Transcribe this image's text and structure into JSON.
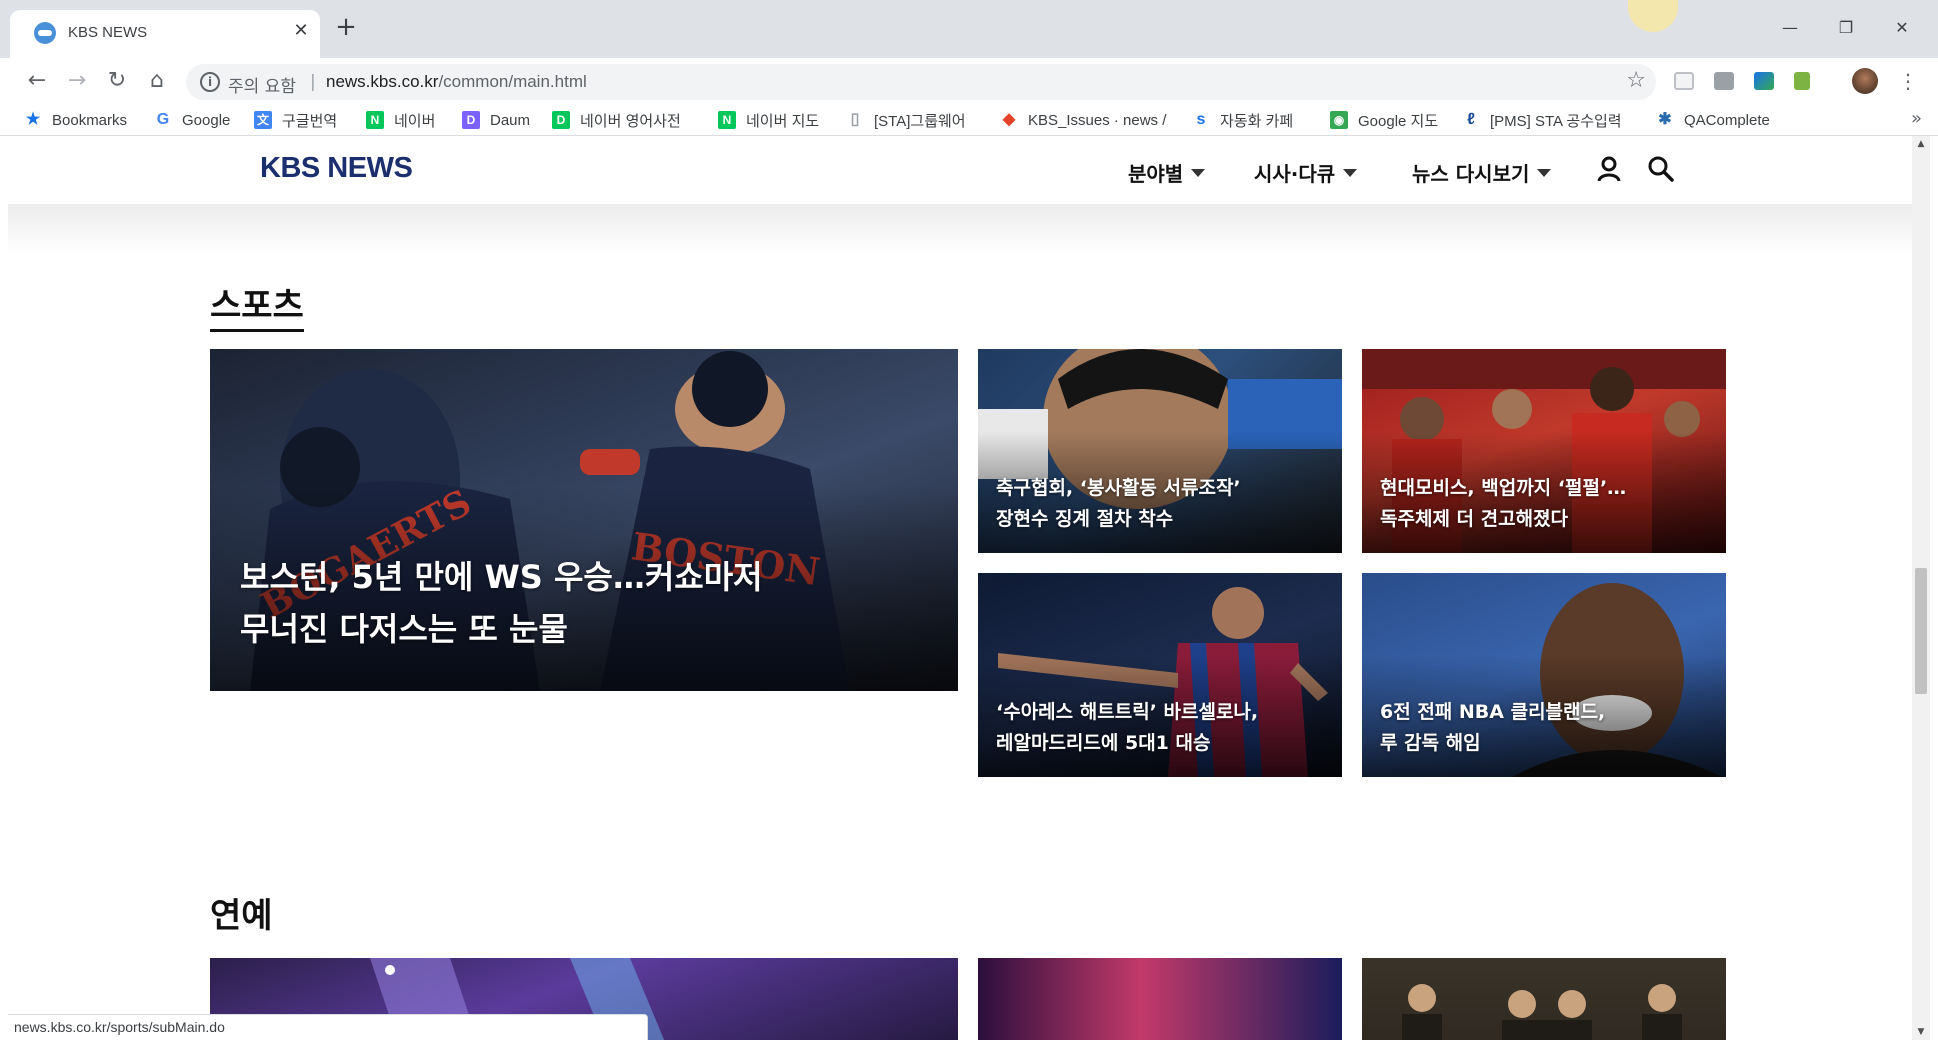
{
  "browser": {
    "tab_title": "KBS NEWS",
    "tab_close": "✕",
    "new_tab": "+",
    "window_controls": {
      "minimize": "—",
      "restore": "❐",
      "close": "✕"
    },
    "nav": {
      "back": "←",
      "forward": "→",
      "reload": "↻",
      "home": "⌂"
    },
    "omnibox": {
      "info_icon": "i",
      "security_text": "주의 요함",
      "separator": "|",
      "url_host": "news.kbs.co.kr",
      "url_path": "/common/main.html",
      "star": "☆"
    },
    "menu_glyph": "⋮",
    "bookmarks": [
      {
        "label": "Bookmarks",
        "icon": "star-icon",
        "glyph": "★",
        "color": "#1a73e8"
      },
      {
        "label": "Google",
        "icon": "google-icon",
        "glyph": "G",
        "color": "#4285f4"
      },
      {
        "label": "구글번역",
        "icon": "translate-icon",
        "glyph": "文",
        "color": "#4285f4"
      },
      {
        "label": "네이버",
        "icon": "naver-icon",
        "glyph": "N",
        "color": "#03c75a"
      },
      {
        "label": "Daum",
        "icon": "daum-icon",
        "glyph": "D",
        "color": "#7b61ff"
      },
      {
        "label": "네이버 영어사전",
        "icon": "dict-icon",
        "glyph": "D",
        "color": "#03c75a"
      },
      {
        "label": "네이버 지도",
        "icon": "naver-map-icon",
        "glyph": "N",
        "color": "#03c75a"
      },
      {
        "label": "[STA]그룹웨어",
        "icon": "page-icon",
        "glyph": "▯",
        "color": "#9aa0a6"
      },
      {
        "label": "KBS_Issues · news /",
        "icon": "gitlab-icon",
        "glyph": "◆",
        "color": "#e24329"
      },
      {
        "label": "자동화 카페",
        "icon": "sta-icon",
        "glyph": "s",
        "color": "#1a73e8"
      },
      {
        "label": "Google 지도",
        "icon": "maps-icon",
        "glyph": "◉",
        "color": "#34a853"
      },
      {
        "label": "[PMS] STA 공수입력",
        "icon": "pms-icon",
        "glyph": "ℓ",
        "color": "#1a4a9b"
      },
      {
        "label": "QAComplete",
        "icon": "qacomplete-icon",
        "glyph": "✱",
        "color": "#2b6cb0"
      }
    ],
    "bookmarks_more": "»",
    "status_url": "news.kbs.co.kr/sports/subMain.do"
  },
  "site": {
    "logo": "KBS NEWS",
    "nav": [
      {
        "label": "분야별"
      },
      {
        "label": "시사·다큐"
      },
      {
        "label": "뉴스 다시보기"
      }
    ]
  },
  "sports": {
    "title": "스포츠",
    "main": {
      "caption_line1": "보스턴, 5년 만에 WS 우승…커쇼마저",
      "caption_line2": "무너진 다저스는 또 눈물"
    },
    "cards": [
      {
        "line1": "축구협회, ‘봉사활동 서류조작’",
        "line2": "장현수 징계 절차 착수"
      },
      {
        "line1": "현대모비스, 백업까지 ‘펄펄’…",
        "line2": "독주체제 더 견고해졌다"
      },
      {
        "line1": "‘수아레스 해트트릭’ 바르셀로나,",
        "line2": "레알마드리드에 5대1 대승"
      },
      {
        "line1": "6전 전패 NBA 클리블랜드,",
        "line2": "루 감독 해임"
      }
    ]
  },
  "entertainment": {
    "title": "연예"
  },
  "colors": {
    "logo": "#1b2f6e",
    "chrome_frame": "#dee1e6",
    "caption_text": "#ffffff"
  }
}
